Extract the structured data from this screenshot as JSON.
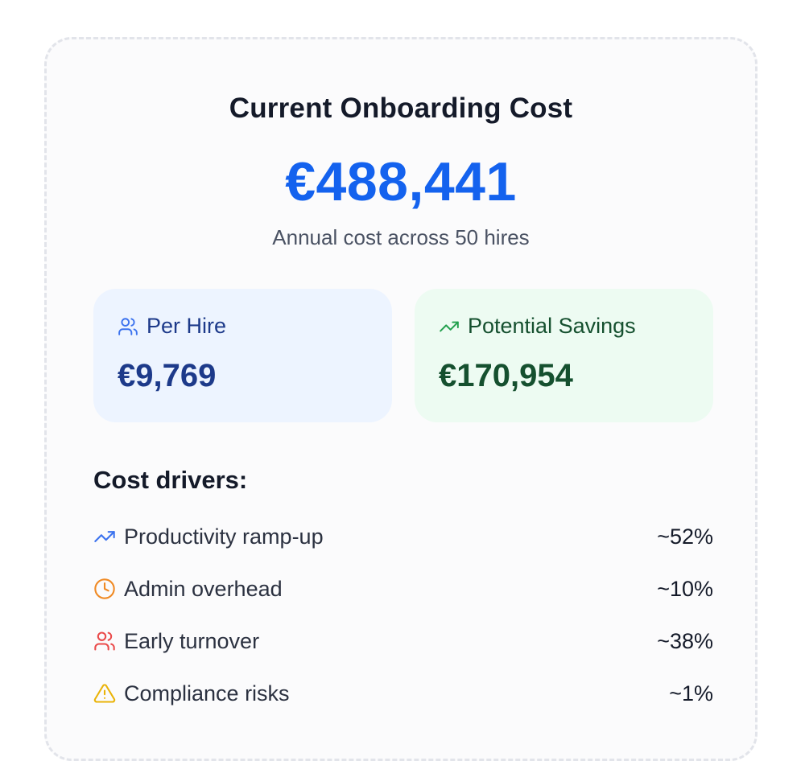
{
  "summary": {
    "title": "Current Onboarding Cost",
    "total": "€488,441",
    "subtitle": "Annual cost across 50 hires"
  },
  "tiles": [
    {
      "icon": "users-icon",
      "label": "Per Hire",
      "value": "€9,769",
      "color": "#1d3a8a"
    },
    {
      "icon": "trending-up-icon",
      "label": "Potential Savings",
      "value": "€170,954",
      "color": "#15502f"
    }
  ],
  "drivers": {
    "title": "Cost drivers:",
    "items": [
      {
        "icon": "trending-up-icon",
        "label": "Productivity ramp-up",
        "percent": "~52%",
        "color": "#3b72ee"
      },
      {
        "icon": "clock-icon",
        "label": "Admin overhead",
        "percent": "~10%",
        "color": "#f08a24"
      },
      {
        "icon": "users-icon",
        "label": "Early turnover",
        "percent": "~38%",
        "color": "#ea4a4a"
      },
      {
        "icon": "warning-icon",
        "label": "Compliance risks",
        "percent": "~1%",
        "color": "#eab308"
      }
    ]
  },
  "colors": {
    "accent": "#1462ee",
    "blue_tile_bg": "#edf4ff",
    "green_tile_bg": "#edfbf2"
  }
}
